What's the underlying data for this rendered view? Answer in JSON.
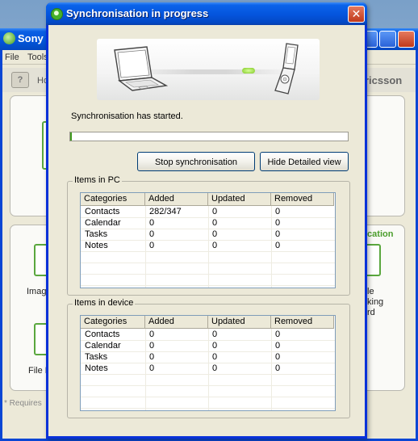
{
  "background_app": {
    "title": "Sony E",
    "menu": [
      "File",
      "Tools"
    ],
    "toolbar_fragment": "Ho",
    "brand_fragment": "ricsson",
    "side_link_fragment": "ication",
    "tile_labels_left": [
      "Imag",
      "File M"
    ],
    "tile_labels_right": [
      "le",
      "king",
      "rd"
    ],
    "footer_fragment": "* Requires"
  },
  "dialog": {
    "title": "Synchronisation in progress",
    "close_icon": "close-icon",
    "status_text": "Synchronisation has started.",
    "progress": 0.005,
    "buttons": {
      "stop": "Stop synchronisation",
      "hide": "Hide Detailed view"
    },
    "groups": [
      {
        "label": "Items in PC",
        "columns": [
          "Categories",
          "Added",
          "Updated",
          "Removed"
        ],
        "rows": [
          [
            "Contacts",
            "282/347",
            "0",
            "0"
          ],
          [
            "Calendar",
            "0",
            "0",
            "0"
          ],
          [
            "Tasks",
            "0",
            "0",
            "0"
          ],
          [
            "Notes",
            "0",
            "0",
            "0"
          ]
        ]
      },
      {
        "label": "Items in device",
        "columns": [
          "Categories",
          "Added",
          "Updated",
          "Removed"
        ],
        "rows": [
          [
            "Contacts",
            "0",
            "0",
            "0"
          ],
          [
            "Calendar",
            "0",
            "0",
            "0"
          ],
          [
            "Tasks",
            "0",
            "0",
            "0"
          ],
          [
            "Notes",
            "0",
            "0",
            "0"
          ]
        ]
      }
    ]
  },
  "colors": {
    "title_bar": "#0454dc",
    "progress_fill": "#3f9a1d",
    "accent_green": "#4a9d2b"
  }
}
